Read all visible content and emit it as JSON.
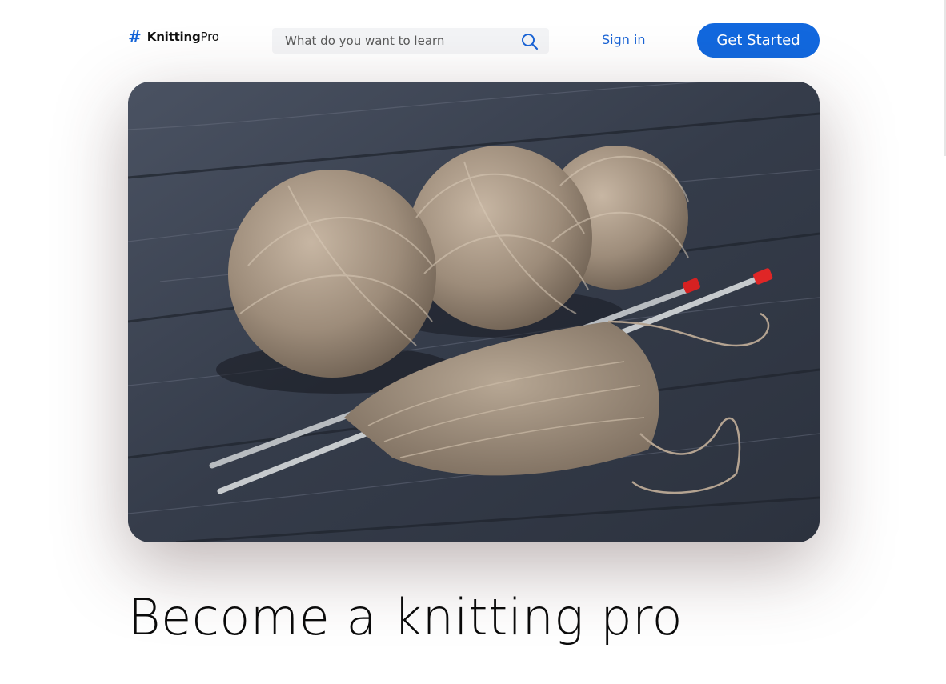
{
  "header": {
    "logo": {
      "icon": "hash-icon",
      "glyph": "#",
      "name_bold": "Knitting",
      "name_light": "Pro"
    },
    "search": {
      "placeholder": "What do you want to learn",
      "icon": "search-icon"
    },
    "signin_label": "Sign in",
    "cta_label": "Get Started"
  },
  "hero": {
    "image": "yarn-balls-with-knitting-needles-photo"
  },
  "main": {
    "headline": "Become a knitting pro"
  },
  "colors": {
    "accent": "#1268de",
    "link": "#1a64d6",
    "search_bg": "#f3f4f6",
    "text": "#0a0a0a"
  }
}
